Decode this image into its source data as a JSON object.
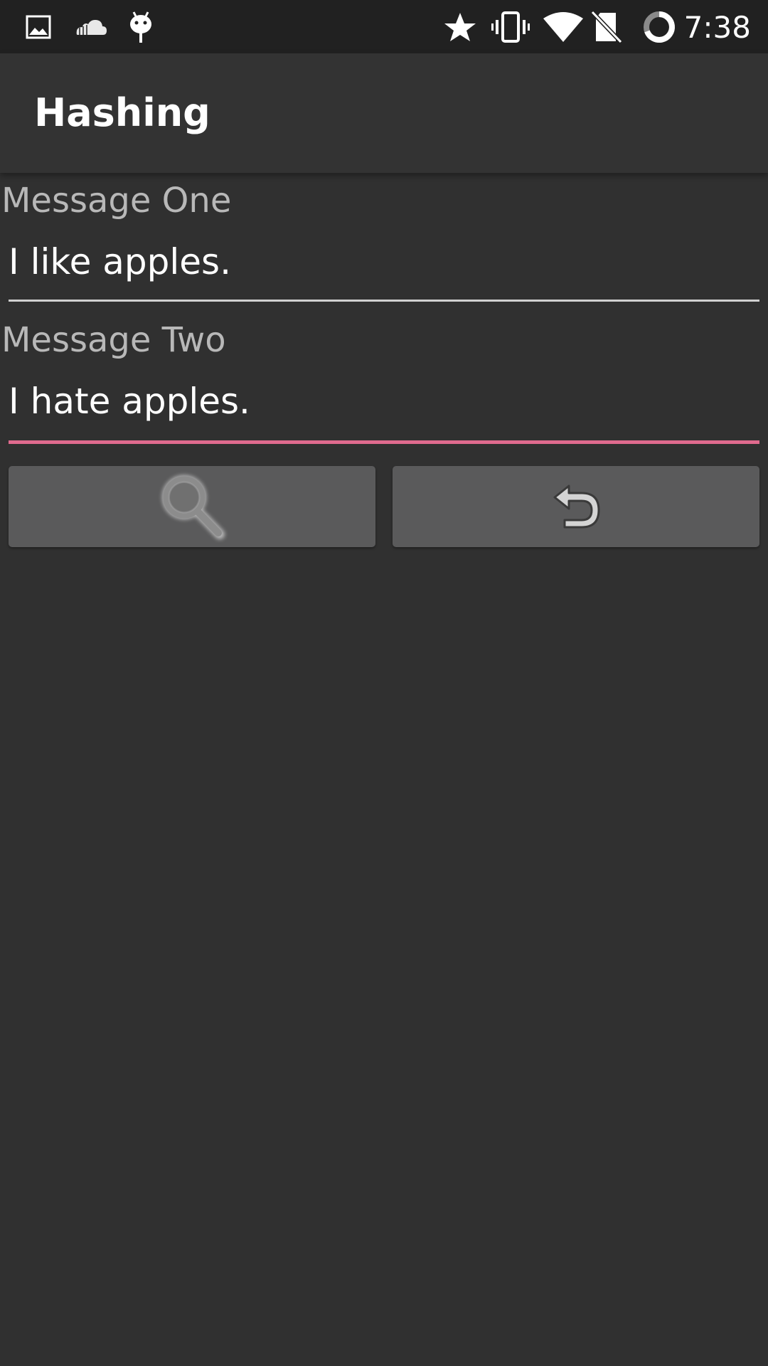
{
  "status_bar": {
    "time": "7:38",
    "left_icons": [
      "image-icon",
      "cloud-icon",
      "android-icon"
    ],
    "right_icons": [
      "star-icon",
      "vibrate-icon",
      "wifi-icon",
      "no-sim-icon",
      "sync-circle-icon"
    ]
  },
  "app_bar": {
    "title": "Hashing"
  },
  "form": {
    "message_one": {
      "label": "Message One",
      "value": "I like apples."
    },
    "message_two": {
      "label": "Message Two",
      "value": "I hate apples."
    }
  },
  "buttons": {
    "hash_icon": "search-icon",
    "reset_icon": "undo-icon"
  },
  "colors": {
    "background": "#303030",
    "status_bar": "#212121",
    "app_bar": "#333333",
    "accent": "#e06a8e",
    "button": "#5a5a5b"
  }
}
